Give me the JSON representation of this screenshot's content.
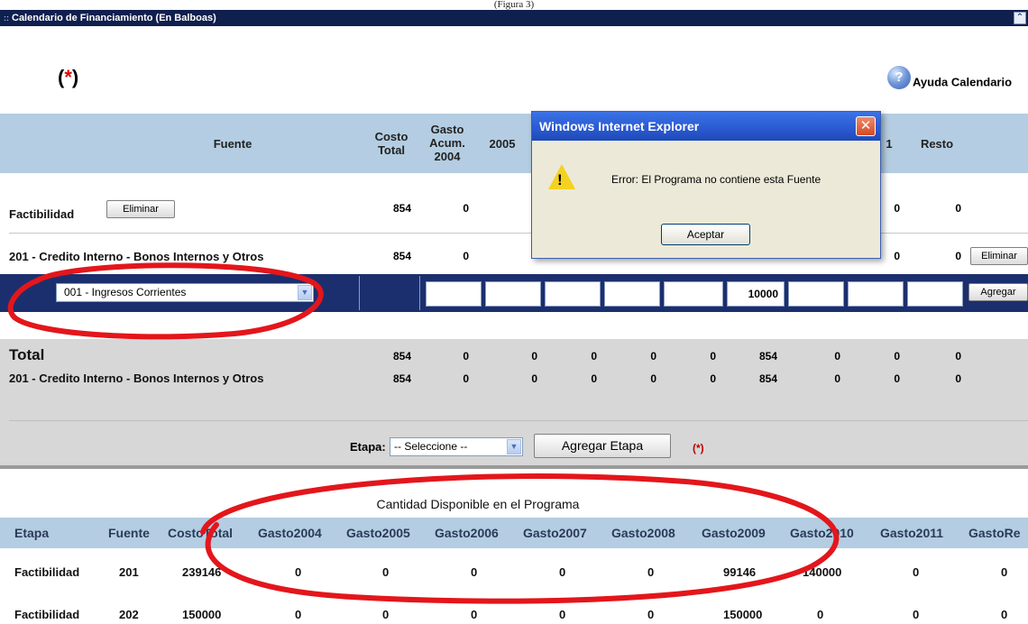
{
  "caption": "(Figura 3)",
  "window": {
    "title": "Calendario de Financiamiento (En Balboas)",
    "collapse_icon": "double-chevron-up-icon"
  },
  "required_marker": {
    "open": "(",
    "star": "*",
    "close": ")"
  },
  "help": {
    "label": "Ayuda Calendario",
    "icon": "help-icon"
  },
  "grid": {
    "headers": {
      "fuente": "Fuente",
      "costo_total": "Costo\nTotal",
      "gasto_acum": "Gasto\nAcum.\n2004",
      "y2005": "2005",
      "y2011": "1",
      "resto": "Resto"
    },
    "rows": [
      {
        "label": "Factibilidad",
        "button": "Eliminar",
        "costo": "854",
        "acum": "0",
        "c2011": "0",
        "resto": "0"
      },
      {
        "label": "201 - Credito Interno - Bonos Internos y Otros",
        "costo": "854",
        "acum": "0",
        "c2011": "0",
        "resto": "0",
        "button": "Eliminar"
      }
    ],
    "input_row": {
      "selected": "001 - Ingresos Corrientes",
      "value_2009": "10000",
      "button": "Agregar"
    },
    "totals": {
      "label": "Total",
      "sub_label": "201 - Credito Interno - Bonos Internos y Otros",
      "values": [
        "854",
        "0",
        "0",
        "0",
        "0",
        "0",
        "854",
        "0",
        "0",
        "0"
      ],
      "sub_values": [
        "854",
        "0",
        "0",
        "0",
        "0",
        "0",
        "854",
        "0",
        "0",
        "0"
      ]
    },
    "etapa": {
      "label": "Etapa:",
      "selected": "-- Seleccione --",
      "button": "Agregar Etapa",
      "required": "(*)"
    }
  },
  "available": {
    "caption": "Cantidad Disponible en el Programa",
    "headers": [
      "Etapa",
      "Fuente",
      "CostoTotal",
      "Gasto2004",
      "Gasto2005",
      "Gasto2006",
      "Gasto2007",
      "Gasto2008",
      "Gasto2009",
      "Gasto2010",
      "Gasto2011",
      "GastoRe"
    ],
    "rows": [
      [
        "Factibilidad",
        "201",
        "239146",
        "0",
        "0",
        "0",
        "0",
        "0",
        "99146",
        "140000",
        "0",
        "0"
      ],
      [
        "Factibilidad",
        "202",
        "150000",
        "0",
        "0",
        "0",
        "0",
        "0",
        "150000",
        "0",
        "0",
        "0"
      ]
    ]
  },
  "dialog": {
    "title": "Windows Internet Explorer",
    "message": "Error:  El Programa no contiene esta Fuente",
    "ok_label": "Aceptar",
    "icon": "warning-icon",
    "close_icon": "close-icon"
  },
  "colors": {
    "title_bar": "#0f1f4e",
    "header_band": "#b4cde2",
    "selection_band": "#1b2f6e",
    "totals_band": "#d7d7d7",
    "annotation_red": "#e3161b"
  }
}
